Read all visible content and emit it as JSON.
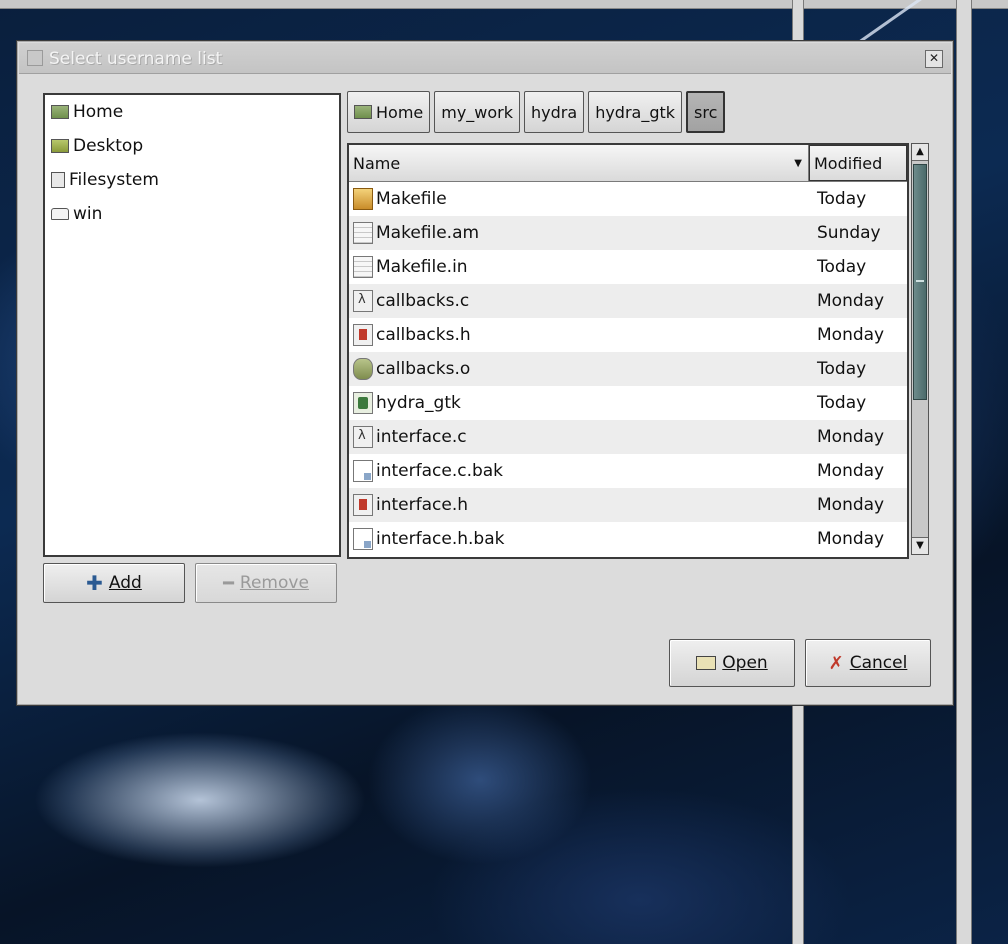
{
  "dialog": {
    "title": "Select username list"
  },
  "places": {
    "items": [
      {
        "label": "Home",
        "icon": "home-folder-icon"
      },
      {
        "label": "Desktop",
        "icon": "desktop-icon"
      },
      {
        "label": "Filesystem",
        "icon": "filesystem-icon"
      },
      {
        "label": "win",
        "icon": "drive-icon"
      }
    ],
    "add_label": "Add",
    "remove_label": "Remove"
  },
  "pathbar": {
    "crumbs": [
      "Home",
      "my_work",
      "hydra",
      "hydra_gtk",
      "src"
    ],
    "active_index": 4
  },
  "filelist": {
    "columns": {
      "name": "Name",
      "modified": "Modified"
    },
    "rows": [
      {
        "name": "Makefile",
        "modified": "Today",
        "icon": "makefile-icon"
      },
      {
        "name": "Makefile.am",
        "modified": "Sunday",
        "icon": "text-file-icon"
      },
      {
        "name": "Makefile.in",
        "modified": "Today",
        "icon": "text-file-icon"
      },
      {
        "name": "callbacks.c",
        "modified": "Monday",
        "icon": "c-source-icon"
      },
      {
        "name": "callbacks.h",
        "modified": "Monday",
        "icon": "c-header-icon"
      },
      {
        "name": "callbacks.o",
        "modified": "Today",
        "icon": "object-file-icon"
      },
      {
        "name": "hydra_gtk",
        "modified": "Today",
        "icon": "executable-icon"
      },
      {
        "name": "interface.c",
        "modified": "Monday",
        "icon": "c-source-icon"
      },
      {
        "name": "interface.c.bak",
        "modified": "Monday",
        "icon": "backup-file-icon"
      },
      {
        "name": "interface.h",
        "modified": "Monday",
        "icon": "c-header-icon"
      },
      {
        "name": "interface.h.bak",
        "modified": "Monday",
        "icon": "backup-file-icon"
      }
    ]
  },
  "actions": {
    "open_label": "Open",
    "cancel_label": "Cancel"
  }
}
